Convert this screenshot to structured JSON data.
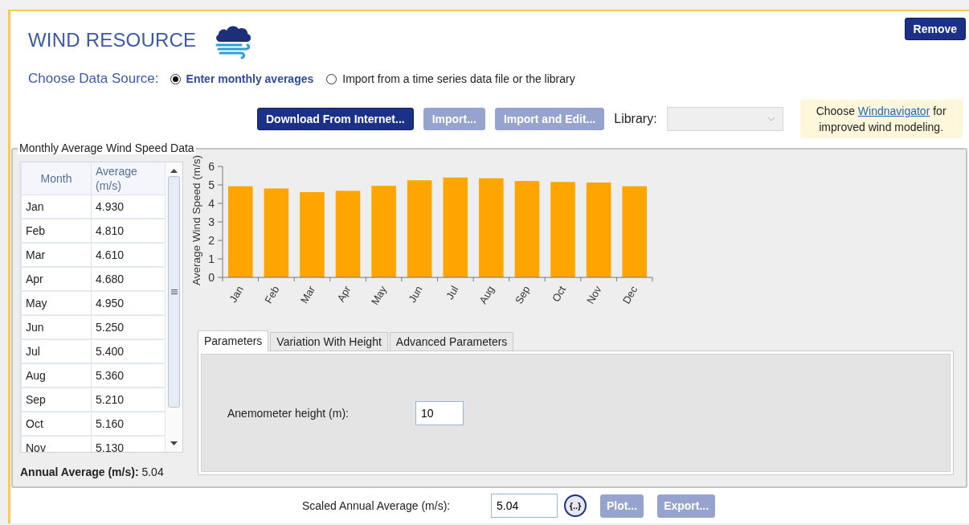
{
  "title": "WIND RESOURCE",
  "remove_button": "Remove",
  "data_source": {
    "label": "Choose Data Source:",
    "options": [
      {
        "label": "Enter monthly averages",
        "selected": true
      },
      {
        "label": "Import from a time series data file or the library",
        "selected": false
      }
    ]
  },
  "toolbar": {
    "buttons": [
      {
        "label": "Download From Internet...",
        "disabled": false
      },
      {
        "label": "Import...",
        "disabled": true
      },
      {
        "label": "Import and Edit...",
        "disabled": true
      }
    ],
    "library_label": "Library:",
    "library_select": {
      "disabled": true
    }
  },
  "note": {
    "before": "Choose ",
    "link": "Windnavigator",
    "after": " for improved wind modeling."
  },
  "monthly_data": {
    "title": "Monthly Average Wind Speed Data",
    "table": {
      "columns": [
        "Month",
        "Average (m/s)"
      ],
      "rows": [
        [
          "Jan",
          "4.930"
        ],
        [
          "Feb",
          "4.810"
        ],
        [
          "Mar",
          "4.610"
        ],
        [
          "Apr",
          "4.680"
        ],
        [
          "May",
          "4.950"
        ],
        [
          "Jun",
          "5.250"
        ],
        [
          "Jul",
          "5.400"
        ],
        [
          "Aug",
          "5.360"
        ],
        [
          "Sep",
          "5.210"
        ],
        [
          "Oct",
          "5.160"
        ],
        [
          "Nov",
          "5.130"
        ]
      ]
    },
    "annual_average": {
      "label": "Annual Average (m/s):",
      "value": "5.04"
    },
    "chart_data": {
      "type": "bar",
      "ylabel": "Average Wind Speed (m/s)",
      "categories": [
        "Jan",
        "Feb",
        "Mar",
        "Apr",
        "May",
        "Jun",
        "Jul",
        "Aug",
        "Sep",
        "Oct",
        "Nov",
        "Dec"
      ],
      "series": [
        {
          "color": "#ffa500",
          "values": [
            4.93,
            4.81,
            4.61,
            4.68,
            4.95,
            5.25,
            5.4,
            5.36,
            5.21,
            5.16,
            5.13,
            4.93
          ]
        }
      ],
      "ylim": [
        0,
        6
      ],
      "yticks": [
        0,
        1,
        2,
        3,
        4,
        5,
        6
      ]
    },
    "tabs": [
      {
        "label": "Parameters",
        "selected": true
      },
      {
        "label": "Variation With Height",
        "selected": false
      },
      {
        "label": "Advanced Parameters",
        "selected": false
      }
    ],
    "fields": [
      {
        "label": "Anemometer height (m):",
        "value": "10"
      }
    ]
  },
  "footer": {
    "label": "Scaled Annual Average (m/s):",
    "value": "5.04",
    "expression_button": "{..}",
    "buttons": [
      {
        "label": "Plot...",
        "disabled": true
      },
      {
        "label": "Export...",
        "disabled": true
      }
    ]
  }
}
